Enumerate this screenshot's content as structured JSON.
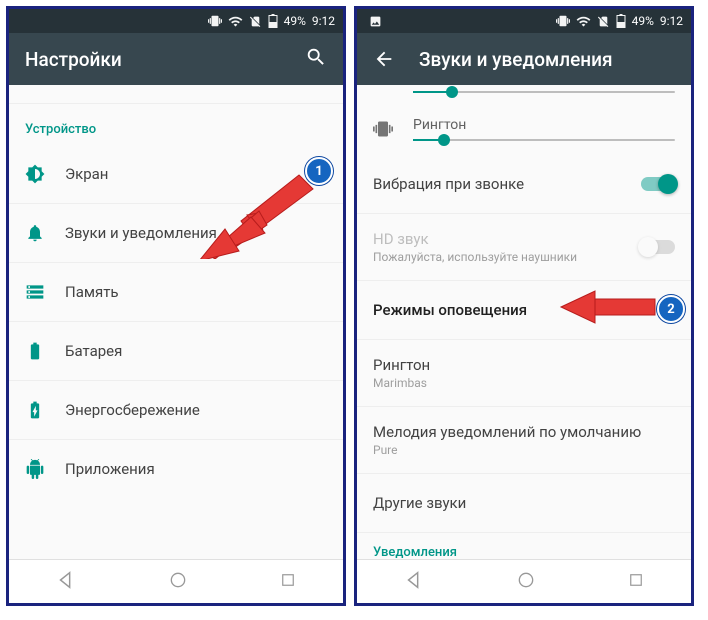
{
  "status": {
    "battery": "49%",
    "time": "9:12"
  },
  "left": {
    "title": "Настройки",
    "section": "Устройство",
    "items": [
      "Экран",
      "Звуки и уведомления",
      "Память",
      "Батарея",
      "Энергосбережение",
      "Приложения"
    ],
    "badge": "1"
  },
  "right": {
    "title": "Звуки и уведомления",
    "ringtone_slider_label": "Рингтон",
    "vibrate_on_call": "Вибрация при звонке",
    "hd_sound": "HD звук",
    "hd_sound_sub": "Пожалуйста, используйте наушники",
    "alert_modes": "Режимы оповещения",
    "ringtone_label": "Рингтон",
    "ringtone_value": "Marimbas",
    "default_notif": "Мелодия уведомлений по умолчанию",
    "default_notif_value": "Pure",
    "other_sounds": "Другие звуки",
    "notifications_section": "Уведомления",
    "badge": "2"
  }
}
